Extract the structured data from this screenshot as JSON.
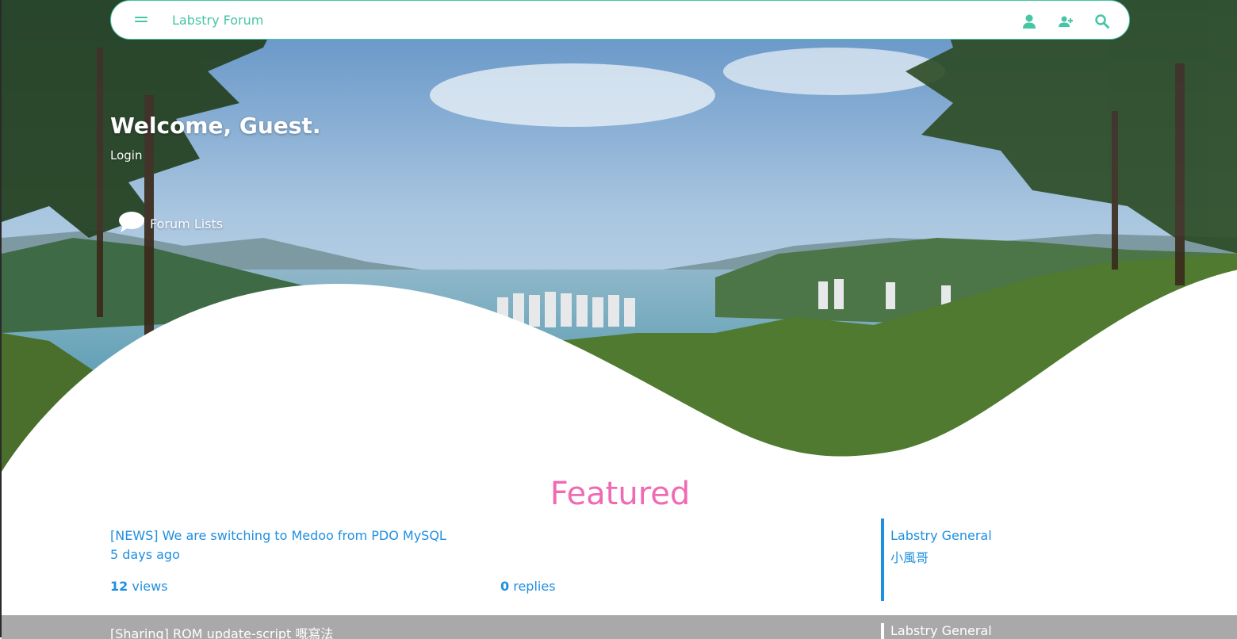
{
  "navbar": {
    "brand": "Labstry Forum",
    "icons": [
      "menu-icon",
      "user-icon",
      "add-user-icon",
      "search-icon"
    ]
  },
  "hero": {
    "welcome": "Welcome, Guest.",
    "login": "Login",
    "forum_lists": "Forum Lists"
  },
  "featured": {
    "heading": "Featured",
    "topics": [
      {
        "title": "[NEWS] We are switching to Medoo from PDO MySQL",
        "time": "5 days ago",
        "views_count": "12",
        "views_label": "views",
        "replies_count": "0",
        "replies_label": "replies",
        "category": "Labstry General",
        "author": "小風哥"
      },
      {
        "title": "[Sharing] ROM update-script 嘅寫法",
        "category": "Labstry General"
      }
    ]
  },
  "colors": {
    "accent": "#45c6a4",
    "link": "#1f8fe0",
    "featured": "#f06ab3",
    "row_alt": "#a9a9a9"
  }
}
